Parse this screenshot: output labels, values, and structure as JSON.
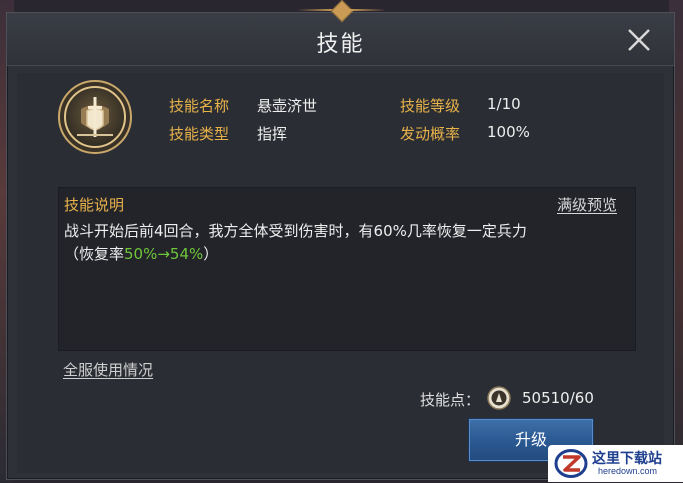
{
  "dialog": {
    "title": "技能",
    "close_icon": "close-icon"
  },
  "skill": {
    "icon": "shield-sword-emblem-icon",
    "name_label": "技能名称",
    "name_value": "悬壶济世",
    "type_label": "技能类型",
    "type_value": "指挥",
    "level_label": "技能等级",
    "level_value": "1/10",
    "chance_label": "发动概率",
    "chance_value": "100%"
  },
  "description": {
    "title": "技能说明",
    "preview_link": "满级预览",
    "line1": "战斗开始后前4回合，我方全体受到伤害时，有60%几率恢复一定兵力",
    "line2_prefix": "（恢复率",
    "line2_highlight": "50%→54%",
    "line2_suffix": "）"
  },
  "server_usage_link": "全服使用情况",
  "skill_points": {
    "label": "技能点：",
    "icon": "skill-point-icon",
    "value": "50510/60"
  },
  "upgrade_button": "升级",
  "watermark": {
    "title": "这里下载站",
    "url": "heredown.com",
    "logo": "z-logo-icon"
  },
  "colors": {
    "label_gold": "#e8b24a",
    "highlight_green": "#6fc63a",
    "button_blue": "#2c5a94",
    "panel_bg": "#2e3138"
  }
}
